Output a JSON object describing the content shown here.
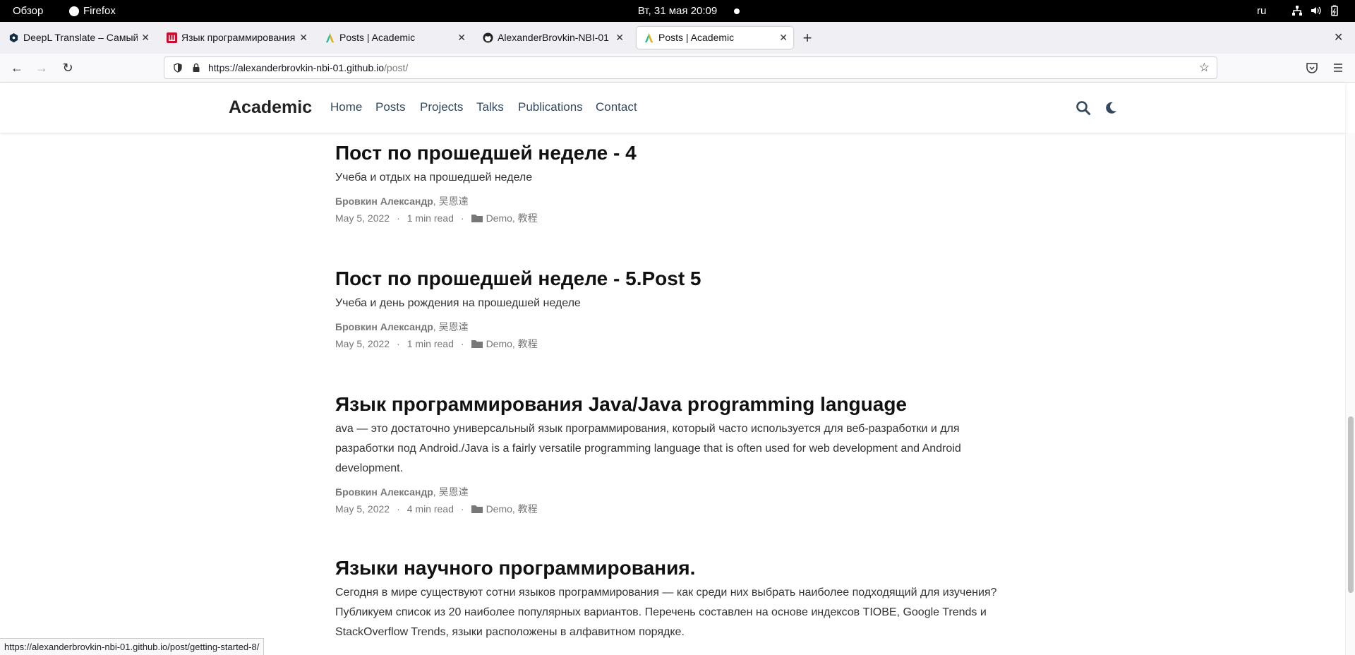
{
  "system_bar": {
    "overview": "Обзор",
    "app": "Firefox",
    "clock": "Вт, 31 мая  20:09",
    "lang": "ru"
  },
  "tabs": [
    {
      "title": "DeepL Translate – Самый",
      "favicon": "deepl-icon",
      "active": false
    },
    {
      "title": "Язык программирования",
      "favicon": "shkola-icon",
      "active": false
    },
    {
      "title": "Posts | Academic",
      "favicon": "academic-icon",
      "active": false
    },
    {
      "title": "AlexanderBrovkin-NBI-01",
      "favicon": "github-icon",
      "active": false
    },
    {
      "title": "Posts | Academic",
      "favicon": "academic-icon",
      "active": true
    }
  ],
  "address": {
    "host": "https://alexanderbrovkin-nbi-01.github.io",
    "path": "/post/"
  },
  "site": {
    "brand": "Academic",
    "menu": [
      "Home",
      "Posts",
      "Projects",
      "Talks",
      "Publications",
      "Contact"
    ]
  },
  "posts": [
    {
      "title": "Пост по прошедшей неделе - 4",
      "summary": "Учеба и отдых на прошедшей неделе",
      "author_main": "Бровкин Александр",
      "author_other": "吴恩達",
      "date": "May 5, 2022",
      "read_time": "1 min read",
      "categories": "Demo, 教程"
    },
    {
      "title": "Пост по прошедшей неделе - 5.Post 5",
      "summary": "Учеба и день рождения на прошедшей неделе",
      "author_main": "Бровкин Александр",
      "author_other": "吴恩達",
      "date": "May 5, 2022",
      "read_time": "1 min read",
      "categories": "Demo, 教程"
    },
    {
      "title": "Язык программирования Java/Java programming language",
      "summary": "ava — это достаточно универсальный язык программирования, который часто используется для веб-разработки и для разработки под Android./Java is a fairly versatile programming language that is often used for web development and Android development.",
      "author_main": "Бровкин Александр",
      "author_other": "吴恩達",
      "date": "May 5, 2022",
      "read_time": "4 min read",
      "categories": "Demo, 教程"
    },
    {
      "title": "Языки научного программирования.",
      "summary": "Сегодня в мире существуют сотни языков программирования — как среди них выбрать наиболее подходящий для изучения? Публикуем список из 20 наиболее популярных вариантов. Перечень составлен на основе индексов TIOBE, Google Trends и StackOverflow Trends, языки расположены в алфавитном порядке."
    }
  ],
  "status_url": "https://alexanderbrovkin-nbi-01.github.io/post/getting-started-8/",
  "colors": {
    "menu": "#34495e",
    "meta": "#777777",
    "accent": "#1565c0"
  }
}
